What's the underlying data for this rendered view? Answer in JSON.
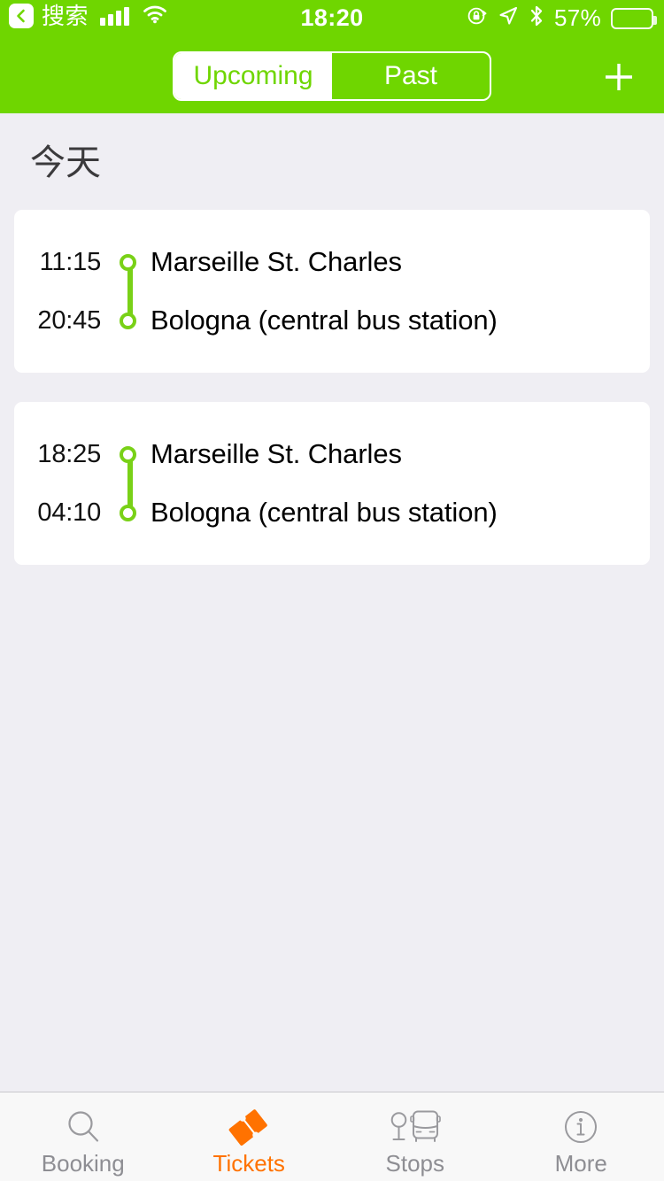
{
  "status_bar": {
    "back_label": "搜索",
    "back_icon": "chevron-left-icon",
    "signal_icon": "cellular-signal-icon",
    "wifi_icon": "wifi-icon",
    "time": "18:20",
    "rotation_lock_icon": "rotation-lock-icon",
    "location_icon": "location-arrow-icon",
    "bluetooth_icon": "bluetooth-icon",
    "battery_percent": "57%",
    "battery_level": 57,
    "battery_color": "#ffc300"
  },
  "header": {
    "brand_color": "#6fd600",
    "segments": [
      {
        "label": "Upcoming",
        "selected": true
      },
      {
        "label": "Past",
        "selected": false
      }
    ],
    "add_button": {
      "icon": "plus-icon",
      "label": "+"
    }
  },
  "main": {
    "section_title": "今天",
    "accent_color": "#79d117",
    "tickets": [
      {
        "departure_time": "11:15",
        "departure_station": "Marseille St. Charles",
        "arrival_time": "20:45",
        "arrival_station": "Bologna (central bus station)"
      },
      {
        "departure_time": "18:25",
        "departure_station": "Marseille St. Charles",
        "arrival_time": "04:10",
        "arrival_station": "Bologna (central bus station)"
      }
    ]
  },
  "tabbar": {
    "active_color": "#ff7200",
    "inactive_color": "#8e8e93",
    "items": [
      {
        "label": "Booking",
        "icon": "search-icon",
        "active": false
      },
      {
        "label": "Tickets",
        "icon": "ticket-icon",
        "active": true
      },
      {
        "label": "Stops",
        "icon": "bus-stop-icon",
        "active": false
      },
      {
        "label": "More",
        "icon": "info-circle-icon",
        "active": false
      }
    ]
  }
}
